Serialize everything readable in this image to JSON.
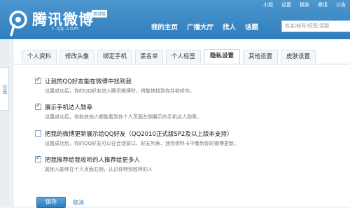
{
  "header": {
    "logo_text": "腾讯微博",
    "beta_badge": "测试版",
    "logo_url": "t.qq.com",
    "top_links": [
      "小旭",
      "设置",
      "换肤",
      "邀请",
      "公告"
    ],
    "nav": [
      "我的主页",
      "广播大厅",
      "找人",
      "话题"
    ],
    "search_placeholder": "姓名/帐号/标签/话题"
  },
  "left_strip": {
    "label": "公告"
  },
  "tabs": [
    "个人资料",
    "修改头像",
    "绑定手机",
    "黑名单",
    "个人标签",
    "隐私设置",
    "其他设置",
    "皮肤设置"
  ],
  "active_tab": "隐私设置",
  "options": [
    {
      "title": "让我的QQ好友能在微博中找到我",
      "desc": "设置成功后，你的QQ好友进入腾讯微博时，将能快找到你并收听你。",
      "checked": true
    },
    {
      "title": "展示手机达人勋章",
      "desc": "设置成功后，你和其他人都能看到你个人页面左侧展示的手机达人勋章。",
      "checked": true
    },
    {
      "title": "把我的微博更新展示给QQ好友（QQ2010正式版SP2及以上版本支持）",
      "desc": "设置成功后，你的QQ好友可以在会话窗口、好友列表、迷你资料卡中看到你的微博更新。",
      "checked": false
    },
    {
      "title": "把我推荐给我收听的人推荐给更多人",
      "desc": "其他人能够在个人页面右侧，认识你特别收听的人",
      "checked": true
    }
  ],
  "buttons": {
    "save": "保存",
    "cancel": "取消"
  }
}
